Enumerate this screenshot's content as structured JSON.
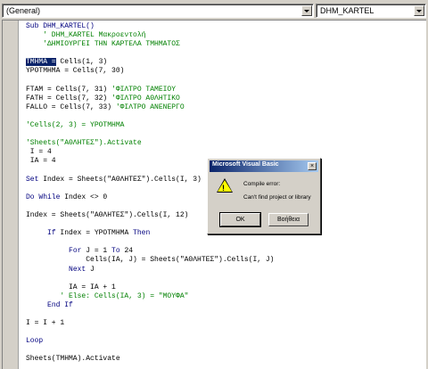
{
  "header": {
    "object_combo": "(General)",
    "procedure_combo": "DHM_KARTEL"
  },
  "code_lines": [
    [
      {
        "t": "Sub DHM_KARTEL()",
        "c": "kw"
      }
    ],
    [
      {
        "t": "    ' DHM_KARTEL Μακροεντολή",
        "c": "cm"
      }
    ],
    [
      {
        "t": "    'ΔΗΜΙΟΥΡΓΕΙ ΤΗΝ ΚΑΡΤΕΛΑ ΤΜΗΜΑΤΟΣ",
        "c": "cm"
      }
    ],
    [
      {
        "t": "",
        "c": ""
      }
    ],
    [
      {
        "t": "ΤΜΗΜΑ =",
        "c": "sel"
      },
      {
        "t": " Cells(1, 3)",
        "c": ""
      }
    ],
    [
      {
        "t": "ΥΡΟΤΜΗΜΑ = Cells(7, 30)",
        "c": ""
      }
    ],
    [
      {
        "t": "",
        "c": ""
      }
    ],
    [
      {
        "t": "FTAM = Cells(7, 31) ",
        "c": ""
      },
      {
        "t": "'ΦΙΛΤΡΟ ΤΑΜΕΙΟΥ",
        "c": "cm"
      }
    ],
    [
      {
        "t": "FATH = Cells(7, 32) ",
        "c": ""
      },
      {
        "t": "'ΦΙΛΤΡΟ ΑΘΛΗΤΙΚΟ",
        "c": "cm"
      }
    ],
    [
      {
        "t": "FALLO = Cells(7, 33) ",
        "c": ""
      },
      {
        "t": "'ΦΙΛΤΡΟ ΑΝΕΝΕΡΓΟ",
        "c": "cm"
      }
    ],
    [
      {
        "t": "",
        "c": ""
      }
    ],
    [
      {
        "t": "'Cells(2, 3) = ΥΡΟΤΜΗΜΑ",
        "c": "cm"
      }
    ],
    [
      {
        "t": "",
        "c": ""
      }
    ],
    [
      {
        "t": "'Sheets(\"ΑΘΛΗΤΕΣ\").Activate",
        "c": "cm"
      }
    ],
    [
      {
        "t": " I = 4",
        "c": ""
      }
    ],
    [
      {
        "t": " IA = 4",
        "c": ""
      }
    ],
    [
      {
        "t": "",
        "c": ""
      }
    ],
    [
      {
        "t": "Set",
        "c": "kw"
      },
      {
        "t": " Index = Sheets(\"ΑΘΛΗΤΕΣ\").Cells(I, 3)",
        "c": ""
      }
    ],
    [
      {
        "t": "",
        "c": ""
      }
    ],
    [
      {
        "t": "Do While",
        "c": "kw"
      },
      {
        "t": " Index <> 0",
        "c": ""
      }
    ],
    [
      {
        "t": "",
        "c": ""
      }
    ],
    [
      {
        "t": "Index = Sheets(\"ΑΘΛΗΤΕΣ\").Cells(I, 12)",
        "c": ""
      }
    ],
    [
      {
        "t": "",
        "c": ""
      }
    ],
    [
      {
        "t": "     ",
        "c": ""
      },
      {
        "t": "If",
        "c": "kw"
      },
      {
        "t": " Index = ΥΡΟΤΜΗΜΑ ",
        "c": ""
      },
      {
        "t": "Then",
        "c": "kw"
      }
    ],
    [
      {
        "t": "",
        "c": ""
      }
    ],
    [
      {
        "t": "          ",
        "c": ""
      },
      {
        "t": "For",
        "c": "kw"
      },
      {
        "t": " J = 1 ",
        "c": ""
      },
      {
        "t": "To",
        "c": "kw"
      },
      {
        "t": " 24",
        "c": ""
      }
    ],
    [
      {
        "t": "              Cells(IA, J) = Sheets(\"ΑΘΛΗΤΕΣ\").Cells(I, J)",
        "c": ""
      }
    ],
    [
      {
        "t": "          ",
        "c": ""
      },
      {
        "t": "Next",
        "c": "kw"
      },
      {
        "t": " J",
        "c": ""
      }
    ],
    [
      {
        "t": "",
        "c": ""
      }
    ],
    [
      {
        "t": "          IA = IA + 1",
        "c": ""
      }
    ],
    [
      {
        "t": "        ",
        "c": ""
      },
      {
        "t": "' Else: Cells(IA, 3) = \"ΜΟΥΦΑ\"",
        "c": "cm"
      }
    ],
    [
      {
        "t": "     ",
        "c": ""
      },
      {
        "t": "End If",
        "c": "kw"
      }
    ],
    [
      {
        "t": "",
        "c": ""
      }
    ],
    [
      {
        "t": "I = I + 1",
        "c": ""
      }
    ],
    [
      {
        "t": "",
        "c": ""
      }
    ],
    [
      {
        "t": "Loop",
        "c": "kw"
      }
    ],
    [
      {
        "t": "",
        "c": ""
      }
    ],
    [
      {
        "t": "Sheets(ΤΜΗΜΑ).Activate",
        "c": ""
      }
    ]
  ],
  "dialog": {
    "title": "Microsoft Visual Basic",
    "close_glyph": "×",
    "warning_glyph": "!",
    "message_line1": "Compile error:",
    "message_line2": "Can't find project or library",
    "ok_label": "OK",
    "help_label": "Βοήθεια"
  },
  "colors": {
    "keyword": "#00007f",
    "comment": "#008000",
    "selection": "#0a246a",
    "titlebar_start": "#0a246a",
    "titlebar_end": "#a6caf0"
  }
}
